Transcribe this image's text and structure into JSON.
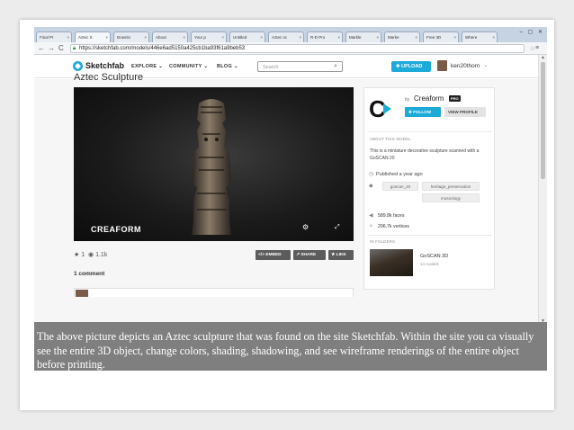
{
  "browser": {
    "tabs": [
      {
        "label": "Final Pr"
      },
      {
        "label": "Aztec S"
      },
      {
        "label": "Downlo"
      },
      {
        "label": "About"
      },
      {
        "label": "Your p"
      },
      {
        "label": "Untitled"
      },
      {
        "label": "Aztec sc"
      },
      {
        "label": "R-D Pro"
      },
      {
        "label": "Markle"
      },
      {
        "label": "Marke"
      },
      {
        "label": "Free 3D"
      },
      {
        "label": "Where"
      }
    ],
    "url": "https://sketchfab.com/models/446e6ad5150a425cb1ba93f61a9beb53"
  },
  "header": {
    "logo": "Sketchfab",
    "menu": [
      "EXPLORE",
      "COMMUNITY",
      "BLOG"
    ],
    "search_placeholder": "Search",
    "upload_label": "UPLOAD",
    "username": "ken20thom"
  },
  "model": {
    "title": "Aztec Sculpture",
    "watermark": "CREAFORM",
    "likes": "1",
    "views": "1.1k",
    "buttons": [
      "EMBED",
      "SHARE",
      "LIKE"
    ],
    "comments_label": "1 comment"
  },
  "creator": {
    "by": "by",
    "name": "Creaform",
    "badge": "PRO",
    "follow_label": "FOLLOW",
    "profile_label": "VIEW PROFILE"
  },
  "about": {
    "heading": "ABOUT THIS MODEL",
    "description": "This is a miniature decorative sculpture scanned with a GoSCAN 20",
    "published": "Published a year ago",
    "tags": [
      "goscan_20",
      "heritage_preservation",
      "museology"
    ],
    "faces": "589.8k faces",
    "vertices": "296.7k vertices"
  },
  "folders": {
    "heading": "IN FOLDERS",
    "name": "GoSCAN 3D",
    "count": "14 models"
  },
  "caption": "The above picture depicts an Aztec sculpture that was found on the site Sketchfab. Within the site you ca visually see the entire 3D object, change colors, shading, shadowing, and see wireframe renderings of the entire object before printing.",
  "colors": {
    "accent": "#1caad9",
    "caption_bg": "#7f7f7f"
  }
}
